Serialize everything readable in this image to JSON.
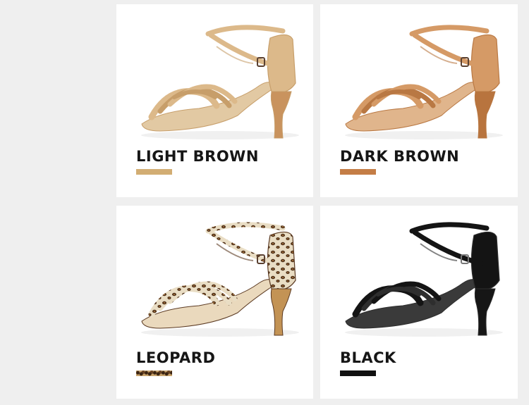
{
  "variants": [
    {
      "label": "LIGHT BROWN",
      "color": "#d2ad73",
      "shoe_color": "#dcb98a",
      "shade": "#c79e6a",
      "heel": "#c9935e",
      "sole": "#e2c9a3"
    },
    {
      "label": "DARK BROWN",
      "color": "#c47d46",
      "shoe_color": "#d59a66",
      "shade": "#b97843",
      "heel": "#b8743e",
      "sole": "#e0b58c"
    },
    {
      "label": "LEOPARD",
      "color": "#c9a46d",
      "shoe_color": "#e9ddc4",
      "shade": "#5b3a22",
      "heel": "#c39355",
      "sole": "#ead9bd"
    },
    {
      "label": "BLACK",
      "color": "#111111",
      "shoe_color": "#141414",
      "shade": "#2e2e2e",
      "heel": "#161616",
      "sole": "#3a3a3a"
    }
  ],
  "icons": [
    "latin-dance-sandal-icon"
  ]
}
